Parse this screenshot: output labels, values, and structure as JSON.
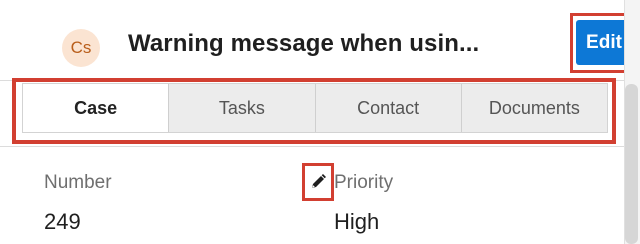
{
  "header": {
    "avatar_initials": "Cs",
    "title": "Warning message when usin...",
    "edit_label": "Edit"
  },
  "tabs": [
    {
      "label": "Case",
      "active": true
    },
    {
      "label": "Tasks",
      "active": false
    },
    {
      "label": "Contact",
      "active": false
    },
    {
      "label": "Documents",
      "active": false
    }
  ],
  "fields": {
    "number": {
      "label": "Number",
      "value": "249"
    },
    "priority": {
      "label": "Priority",
      "value": "High"
    }
  },
  "icons": {
    "inline_edit": "pencil-icon"
  },
  "colors": {
    "accent": "#0d78d6",
    "highlight": "#d23f31",
    "avatar_bg": "#fbe4d2",
    "avatar_text": "#b95e1b"
  }
}
